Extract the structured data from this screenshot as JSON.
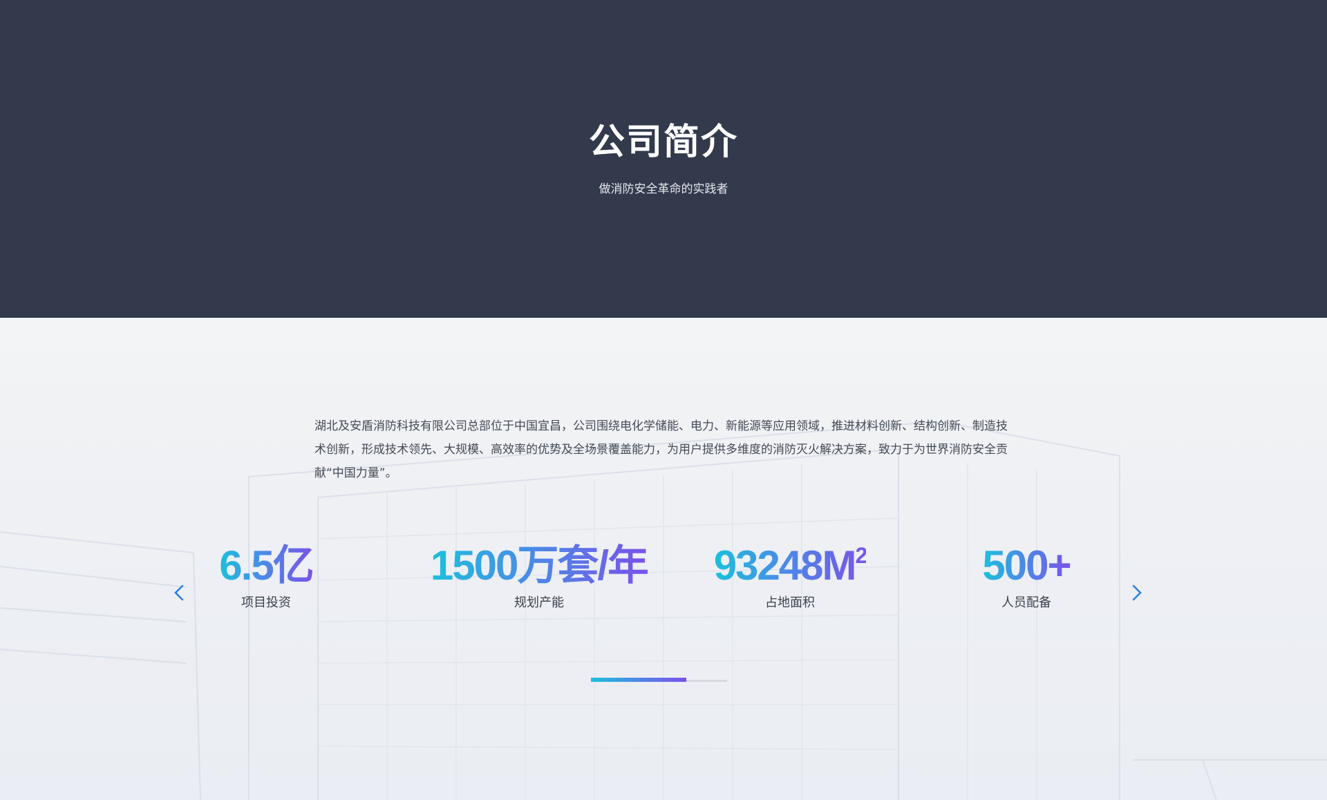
{
  "hero": {
    "title": "公司简介",
    "subtitle": "做消防安全革命的实践者"
  },
  "intro": {
    "text": "湖北及安盾消防科技有限公司总部位于中国宜昌，公司围绕电化学储能、电力、新能源等应用领域，推进材料创新、结构创新、制造技术创新，形成技术领先、大规模、高效率的优势及全场景覆盖能力，为用户提供多维度的消防灭火解决方案，致力于为世界消防安全贡献“中国力量”。"
  },
  "stats": [
    {
      "value": "6.5亿",
      "label": "项目投资"
    },
    {
      "value": "1500万套/年",
      "label": "规划产能"
    },
    {
      "value": "93248M",
      "sup": "2",
      "label": "占地面积"
    },
    {
      "value": "500+",
      "label": "人员配备"
    }
  ],
  "carousel": {
    "prev_icon": "chevron-left-icon",
    "next_icon": "chevron-right-icon",
    "progress": 0.7
  },
  "colors": {
    "hero_bg": "#323a4c",
    "gradient_start": "#1cc0dc",
    "gradient_end": "#7a52e8",
    "arrow": "#2f7fe0"
  }
}
